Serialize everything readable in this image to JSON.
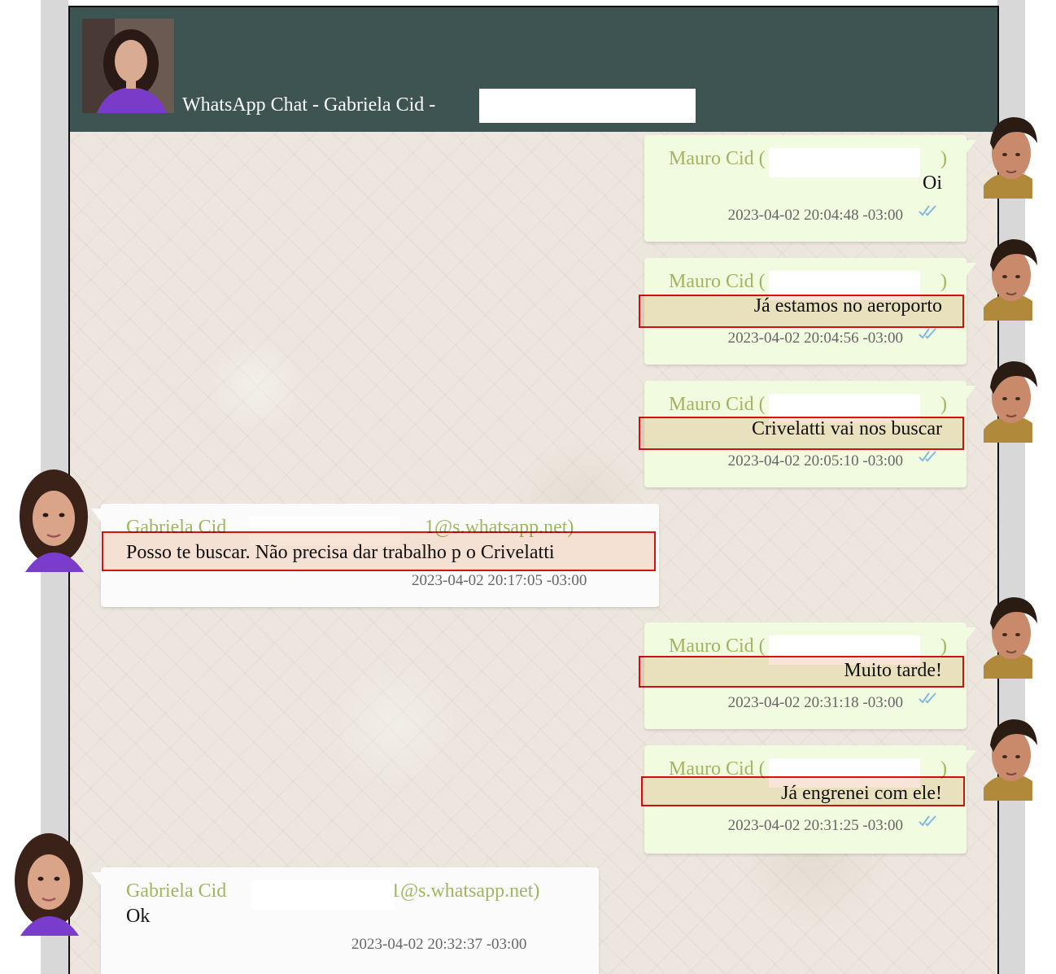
{
  "chat": {
    "title": "WhatsApp Chat - Gabriela Cid -",
    "messages": [
      {
        "sender": "Mauro Cid (",
        "sender_suffix": ")",
        "text": "Oi",
        "timestamp": "2023-04-02 20:04:48 -03:00",
        "direction": "outgoing",
        "highlighted": false,
        "status_icon": "double-check-icon"
      },
      {
        "sender": "Mauro Cid (",
        "sender_suffix": ")",
        "text": "Já estamos no aeroporto",
        "timestamp": "2023-04-02 20:04:56 -03:00",
        "direction": "outgoing",
        "highlighted": true,
        "status_icon": "double-check-icon"
      },
      {
        "sender": "Mauro Cid (",
        "sender_suffix": ")",
        "text": "Crivelatti vai nos buscar",
        "timestamp": "2023-04-02 20:05:10 -03:00",
        "direction": "outgoing",
        "highlighted": true,
        "status_icon": "double-check-icon"
      },
      {
        "sender": "Gabriela Cid",
        "sender_suffix": "1@s.whatsapp.net)",
        "text": "Posso te buscar. Não precisa dar trabalho p o Crivelatti",
        "timestamp": "2023-04-02 20:17:05 -03:00",
        "direction": "incoming",
        "highlighted": true
      },
      {
        "sender": "Mauro Cid (",
        "sender_suffix": ")",
        "text": "Muito tarde!",
        "timestamp": "2023-04-02 20:31:18 -03:00",
        "direction": "outgoing",
        "highlighted": true,
        "status_icon": "double-check-icon"
      },
      {
        "sender": "Mauro Cid (",
        "sender_suffix": ")",
        "text": "Já engrenei com ele!",
        "timestamp": "2023-04-02 20:31:25 -03:00",
        "direction": "outgoing",
        "highlighted": true,
        "status_icon": "double-check-icon"
      },
      {
        "sender": "Gabriela Cid",
        "sender_suffix": "1@s.whatsapp.net)",
        "text": "Ok",
        "timestamp": "2023-04-02 20:32:37 -03:00",
        "direction": "incoming",
        "highlighted": false
      }
    ]
  },
  "colors": {
    "header_bg": "#3e5453",
    "chat_bg": "#ece6de",
    "outgoing_bubble": "#f0fbe0",
    "incoming_bubble": "#fbfbfb",
    "sender_name": "#a0b65e",
    "highlight_border": "#e01010",
    "check_marks": "#7fb8e0"
  }
}
